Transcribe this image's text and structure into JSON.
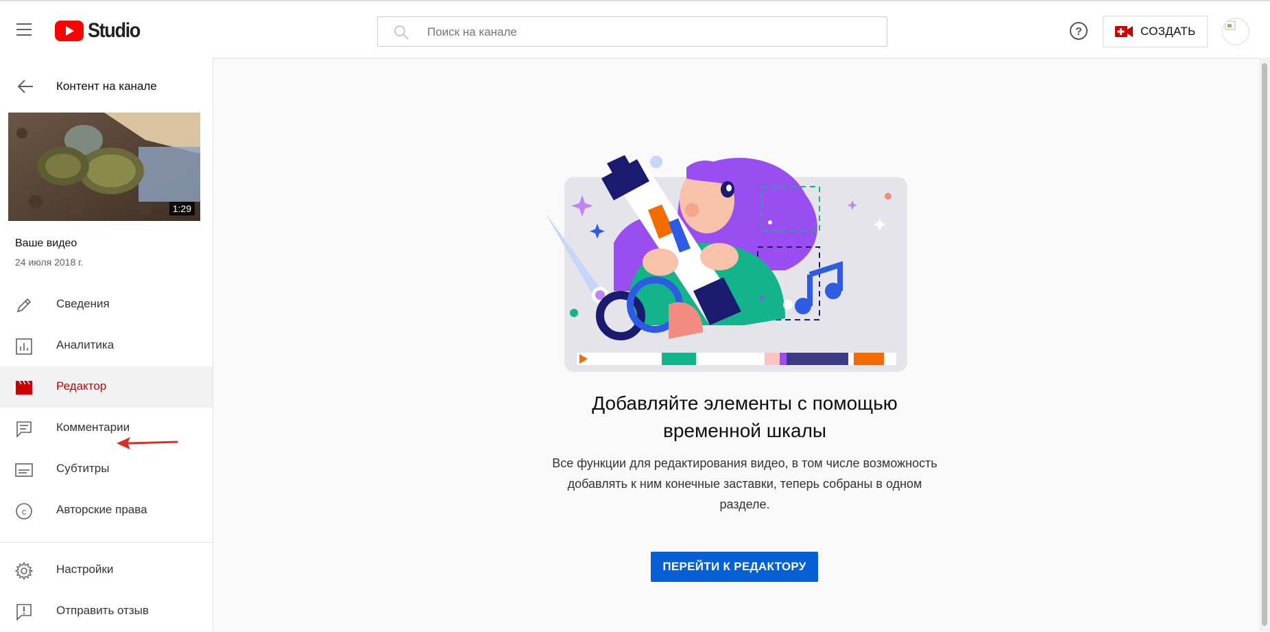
{
  "header": {
    "logo_text": "Studio",
    "search_placeholder": "Поиск на канале",
    "create_label": "СОЗДАТЬ"
  },
  "sidebar": {
    "back_label": "Контент на канале",
    "video": {
      "duration": "1:29",
      "title": "Ваше видео",
      "date": "24 июля 2018 г."
    },
    "items": [
      {
        "label": "Сведения",
        "icon": "pencil-icon",
        "active": false
      },
      {
        "label": "Аналитика",
        "icon": "analytics-icon",
        "active": false
      },
      {
        "label": "Редактор",
        "icon": "clapperboard-icon",
        "active": true
      },
      {
        "label": "Комментарии",
        "icon": "comments-icon",
        "active": false
      },
      {
        "label": "Субтитры",
        "icon": "subtitles-icon",
        "active": false
      },
      {
        "label": "Авторские права",
        "icon": "copyright-icon",
        "active": false
      }
    ],
    "bottom_items": [
      {
        "label": "Настройки",
        "icon": "gear-icon"
      },
      {
        "label": "Отправить отзыв",
        "icon": "feedback-icon"
      }
    ]
  },
  "main": {
    "heading": "Добавляйте элементы с помощью временной шкалы",
    "description": "Все функции для редактирования видео, в том числе возможность добавлять к ним конечные заставки, теперь собраны в одном разделе.",
    "button_label": "ПЕРЕЙТИ К РЕДАКТОРУ"
  },
  "colors": {
    "brand_red": "#ff0000",
    "active_red": "#cc0000",
    "primary_blue": "#065fd4",
    "annotation_red": "#d93025"
  }
}
